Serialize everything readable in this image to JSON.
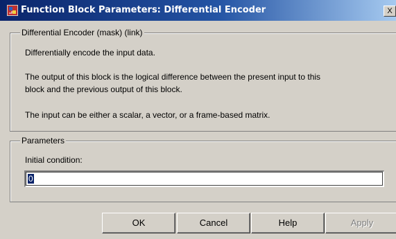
{
  "window": {
    "title": "Function Block Parameters: Differential Encoder",
    "close_label": "X"
  },
  "mask_group": {
    "legend": "Differential Encoder (mask) (link)",
    "description_line1": "Differentially encode the input data.",
    "description_line2": "The output of this block is the logical difference between the present input to this",
    "description_line3": "block and the previous output of this block.",
    "description_line4": "The input can be either a scalar, a vector, or a frame-based matrix."
  },
  "parameters_group": {
    "legend": "Parameters",
    "initial_condition_label": "Initial condition:",
    "initial_condition_value": "0"
  },
  "buttons": {
    "ok": "OK",
    "cancel": "Cancel",
    "help": "Help",
    "apply": "Apply"
  },
  "colors": {
    "title_bar_start": "#0a246a",
    "title_bar_end": "#a6caf0",
    "dialog_background": "#d4d0c8"
  },
  "icons": {
    "app": "simulink-block-icon",
    "close": "close-icon"
  }
}
